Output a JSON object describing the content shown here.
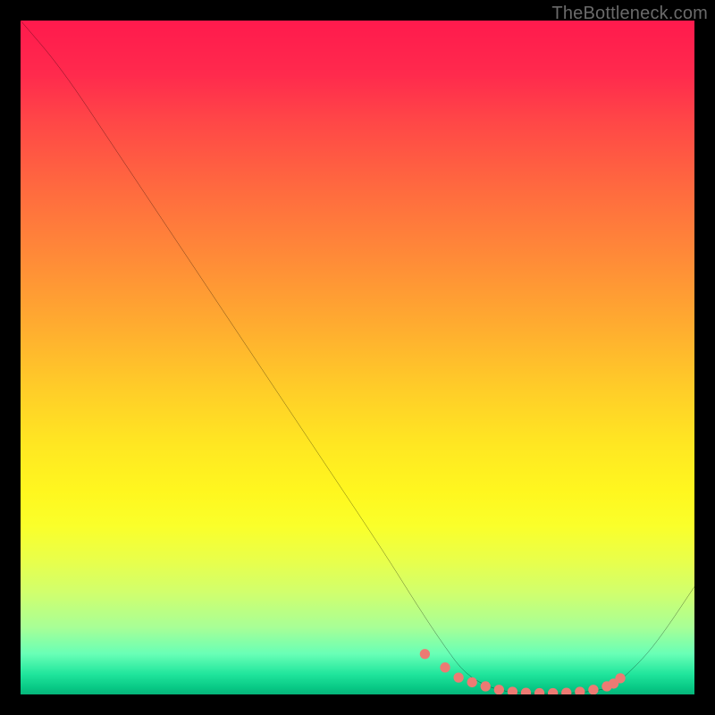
{
  "watermark": "TheBottleneck.com",
  "colors": {
    "background": "#000000",
    "curve_stroke": "#000000",
    "marker_fill": "#ed7a73",
    "gradient_top": "#ff1a4d",
    "gradient_bottom": "#06b57a"
  },
  "chart_data": {
    "type": "line",
    "title": "",
    "xlabel": "",
    "ylabel": "",
    "xlim": [
      0,
      100
    ],
    "ylim": [
      0,
      100
    ],
    "grid": false,
    "legend": false,
    "series": [
      {
        "name": "bottleneck-curve",
        "x": [
          0,
          6,
          14,
          22,
          30,
          38,
          46,
          54,
          59,
          63,
          66,
          70,
          74,
          78,
          82,
          86,
          88,
          90,
          93,
          96,
          100
        ],
        "y": [
          100,
          93,
          81,
          69,
          57,
          45,
          33,
          21,
          13,
          7,
          3,
          0.8,
          0.2,
          0.1,
          0.2,
          0.6,
          1.3,
          3,
          6,
          10,
          16
        ]
      }
    ],
    "markers": {
      "name": "highlighted-range",
      "x": [
        60,
        63,
        65,
        67,
        69,
        71,
        73,
        75,
        77,
        79,
        81,
        83,
        85,
        87,
        88,
        89
      ],
      "y": [
        6,
        4,
        2.5,
        1.8,
        1.2,
        0.7,
        0.4,
        0.25,
        0.2,
        0.2,
        0.25,
        0.4,
        0.7,
        1.2,
        1.6,
        2.4
      ]
    }
  }
}
